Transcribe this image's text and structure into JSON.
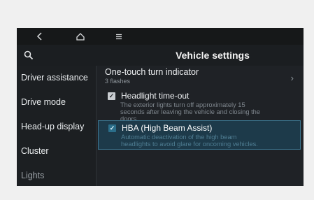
{
  "topbar": {
    "back_icon": "back-chevron-icon",
    "home_icon": "home-icon",
    "menu_icon": "menu-icon"
  },
  "header": {
    "title": "Vehicle settings",
    "search_icon": "search-icon"
  },
  "sidebar": {
    "items": [
      {
        "label": "Driver assistance"
      },
      {
        "label": "Drive mode"
      },
      {
        "label": "Head-up display"
      },
      {
        "label": "Cluster"
      },
      {
        "label": "Lights"
      }
    ]
  },
  "content": {
    "one_touch": {
      "label": "One-touch turn indicator",
      "value": "3 flashes"
    },
    "headlight": {
      "label": "Headlight time-out",
      "desc_line1": "The exterior lights turn off  approximately 15",
      "desc_line2": "seconds after leaving the vehicle and closing the",
      "desc_line3": "doors.",
      "checked": true
    },
    "hba": {
      "label": "HBA (High Beam Assist)",
      "desc_line1": "Automatic deactivation of the high beam",
      "desc_line2": "headlights to avoid glare for oncoming vehicles.",
      "checked": true
    }
  },
  "colors": {
    "screen_bg": "#1f2226",
    "highlight_bg": "#1d3a4a",
    "highlight_border": "#3b7590"
  }
}
